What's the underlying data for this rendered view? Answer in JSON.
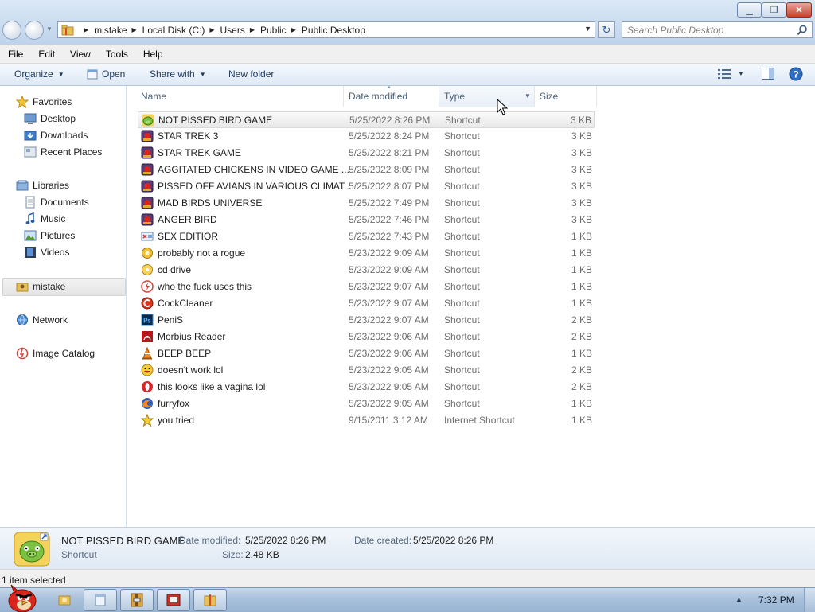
{
  "window": {
    "minimize_glyph": "▁",
    "maximize_glyph": "❐",
    "close_glyph": "✕"
  },
  "address": {
    "crumbs": [
      "mistake",
      "Local Disk (C:)",
      "Users",
      "Public",
      "Public Desktop"
    ]
  },
  "search": {
    "placeholder": "Search Public Desktop"
  },
  "menu": [
    "File",
    "Edit",
    "View",
    "Tools",
    "Help"
  ],
  "commands": {
    "organize": "Organize",
    "open": "Open",
    "share_with": "Share with",
    "new_folder": "New folder"
  },
  "nav": {
    "favorites": "Favorites",
    "desktop": "Desktop",
    "downloads": "Downloads",
    "recent_places": "Recent Places",
    "libraries": "Libraries",
    "documents": "Documents",
    "music": "Music",
    "pictures": "Pictures",
    "videos": "Videos",
    "user": "mistake",
    "network": "Network",
    "image_catalog": "Image Catalog"
  },
  "columns": {
    "name": "Name",
    "date_modified": "Date modified",
    "type": "Type",
    "size": "Size"
  },
  "files": [
    {
      "name": "NOT PISSED BIRD GAME",
      "date": "5/25/2022 8:26 PM",
      "type": "Shortcut",
      "size": "3 KB",
      "icon": "green-pig-icon"
    },
    {
      "name": "STAR TREK 3",
      "date": "5/25/2022 8:24 PM",
      "type": "Shortcut",
      "size": "3 KB",
      "icon": "game-app-icon"
    },
    {
      "name": "STAR TREK GAME",
      "date": "5/25/2022 8:21 PM",
      "type": "Shortcut",
      "size": "3 KB",
      "icon": "game-app-icon"
    },
    {
      "name": "AGGITATED CHICKENS IN VIDEO GAME ...",
      "date": "5/25/2022 8:09 PM",
      "type": "Shortcut",
      "size": "3 KB",
      "icon": "game-app-icon"
    },
    {
      "name": "PISSED OFF AVIANS IN VARIOUS CLIMAT...",
      "date": "5/25/2022 8:07 PM",
      "type": "Shortcut",
      "size": "3 KB",
      "icon": "game-app-icon"
    },
    {
      "name": "MAD BIRDS UNIVERSE",
      "date": "5/25/2022 7:49 PM",
      "type": "Shortcut",
      "size": "3 KB",
      "icon": "game-app-icon"
    },
    {
      "name": "ANGER BIRD",
      "date": "5/25/2022 7:46 PM",
      "type": "Shortcut",
      "size": "3 KB",
      "icon": "game-app-icon"
    },
    {
      "name": "SEX EDITIOR",
      "date": "5/25/2022 7:43 PM",
      "type": "Shortcut",
      "size": "1 KB",
      "icon": "editor-icon"
    },
    {
      "name": "probably not a rogue",
      "date": "5/23/2022 9:09 AM",
      "type": "Shortcut",
      "size": "1 KB",
      "icon": "gear-icon"
    },
    {
      "name": "cd drive",
      "date": "5/23/2022 9:09 AM",
      "type": "Shortcut",
      "size": "1 KB",
      "icon": "disc-icon"
    },
    {
      "name": "who the fuck uses this",
      "date": "5/23/2022 9:07 AM",
      "type": "Shortcut",
      "size": "1 KB",
      "icon": "flash-icon"
    },
    {
      "name": "CockCleaner",
      "date": "5/23/2022 9:07 AM",
      "type": "Shortcut",
      "size": "1 KB",
      "icon": "cleaner-icon"
    },
    {
      "name": "PeniS",
      "date": "5/23/2022 9:07 AM",
      "type": "Shortcut",
      "size": "2 KB",
      "icon": "ps-icon"
    },
    {
      "name": "Morbius Reader",
      "date": "5/23/2022 9:06 AM",
      "type": "Shortcut",
      "size": "2 KB",
      "icon": "pdf-reader-icon"
    },
    {
      "name": "BEEP BEEP",
      "date": "5/23/2022 9:06 AM",
      "type": "Shortcut",
      "size": "1 KB",
      "icon": "traffic-cone-icon"
    },
    {
      "name": "doesn't work lol",
      "date": "5/23/2022 9:05 AM",
      "type": "Shortcut",
      "size": "2 KB",
      "icon": "smiley-icon"
    },
    {
      "name": "this looks like a vagina lol",
      "date": "5/23/2022 9:05 AM",
      "type": "Shortcut",
      "size": "2 KB",
      "icon": "opera-icon"
    },
    {
      "name": "furryfox",
      "date": "5/23/2022 9:05 AM",
      "type": "Shortcut",
      "size": "1 KB",
      "icon": "firefox-icon"
    },
    {
      "name": "you tried",
      "date": "9/15/2011 3:12 AM",
      "type": "Internet Shortcut",
      "size": "1 KB",
      "icon": "star-icon"
    }
  ],
  "details": {
    "name": "NOT PISSED BIRD GAME",
    "type": "Shortcut",
    "date_modified_label": "Date modified:",
    "date_modified": "5/25/2022 8:26 PM",
    "size_label": "Size:",
    "size": "2.48 KB",
    "date_created_label": "Date created:",
    "date_created": "5/25/2022 8:26 PM"
  },
  "status": {
    "text": "1 item selected"
  },
  "taskbar": {
    "clock": "7:32 PM"
  },
  "colors": {
    "window_chrome": "#c9dbef",
    "taskbar": "#a9c1db",
    "selection": "#e8e8e8"
  }
}
